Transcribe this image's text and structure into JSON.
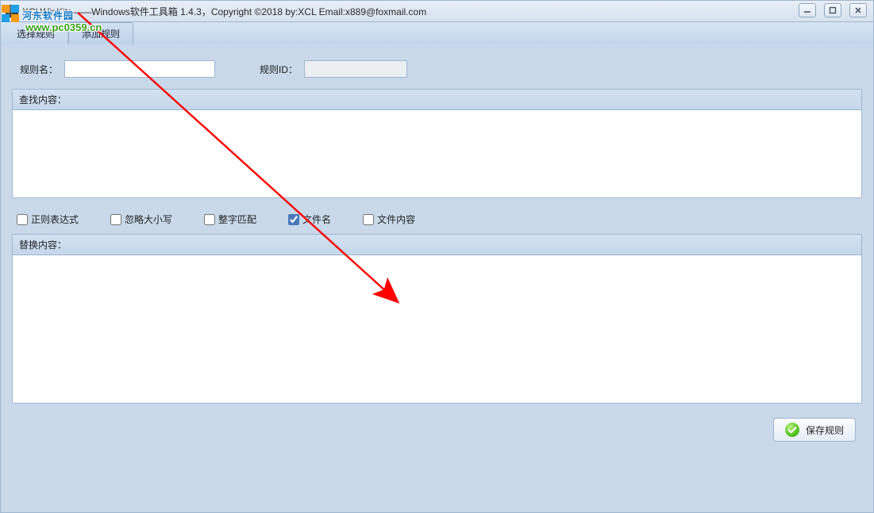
{
  "window": {
    "title": "XCLWinKits——Windows软件工具箱    1.4.3，Copyright ©2018 by:XCL Email:x889@foxmail.com"
  },
  "tabs": {
    "select_rule": "选择规则",
    "add_rule": "添加规则"
  },
  "fields": {
    "rule_name_label": "规则名：",
    "rule_name_value": "",
    "rule_id_label": "规则ID：",
    "rule_id_value": ""
  },
  "groups": {
    "find_header": "查找内容：",
    "find_value": "",
    "replace_header": "替换内容：",
    "replace_value": ""
  },
  "checks": {
    "regex": "正则表达式",
    "ignore_case": "忽略大小写",
    "whole_word": "整字匹配",
    "file_name": "文件名",
    "file_content": "文件内容"
  },
  "checks_state": {
    "regex": false,
    "ignore_case": false,
    "whole_word": false,
    "file_name": true,
    "file_content": false
  },
  "buttons": {
    "save_rule": "保存规则"
  },
  "watermark": {
    "top": "河东软件园",
    "bottom": "www.pc0359.cn"
  }
}
